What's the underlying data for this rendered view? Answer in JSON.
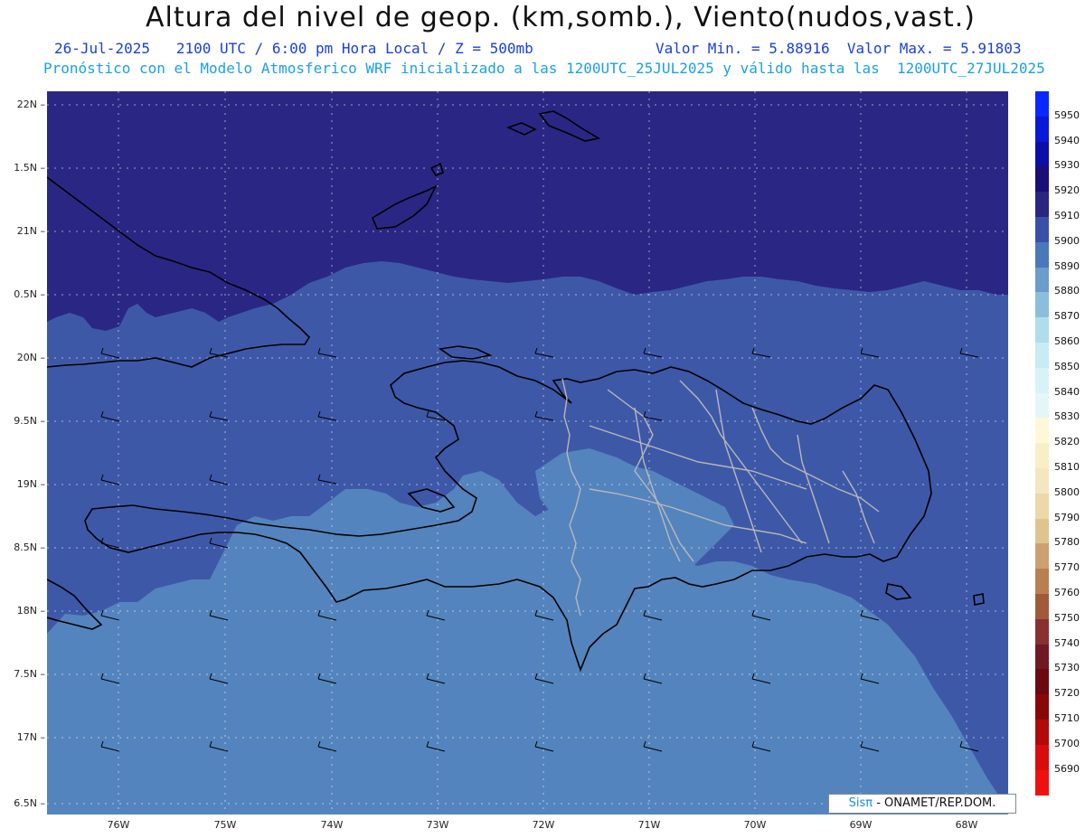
{
  "header": {
    "title": "Altura del nivel de geop. (km,somb.), Viento(nudos,vast.)",
    "date_time": "26-Jul-2025   2100 UTC / 6:00 pm Hora Local / Z = 500mb",
    "min_max": "Valor Min. = 5.88916  Valor Max. = 5.91803",
    "run_info": "Pronóstico con el Modelo Atmosferico WRF inicializado a las 1200UTC_25JUL2025 y válido hasta las  1200UTC_27JUL2025"
  },
  "axes": {
    "lat_labels": [
      "22N",
      "1.5N",
      "21N",
      "0.5N",
      "20N",
      "9.5N",
      "19N",
      "8.5N",
      "18N",
      "7.5N",
      "17N",
      "6.5N"
    ],
    "lon_labels": [
      "76W",
      "75W",
      "74W",
      "73W",
      "72W",
      "71W",
      "70W",
      "69W",
      "68W"
    ]
  },
  "colorbar": {
    "levels": [
      "5950",
      "5940",
      "5930",
      "5920",
      "5910",
      "5900",
      "5890",
      "5880",
      "5870",
      "5860",
      "5850",
      "5840",
      "5830",
      "5820",
      "5810",
      "5800",
      "5790",
      "5780",
      "5770",
      "5760",
      "5750",
      "5740",
      "5730",
      "5720",
      "5710",
      "5700",
      "5690"
    ],
    "colors": [
      "#0a28ff",
      "#0a18d8",
      "#0c0ea8",
      "#1a0e78",
      "#2a2580",
      "#3a50a8",
      "#4a78b8",
      "#6a9ccc",
      "#8cbedc",
      "#b0dcec",
      "#c8ecf4",
      "#d8f2f8",
      "#e4f6f8",
      "#fff8d8",
      "#f8eec8",
      "#f4e6c0",
      "#ecd8a8",
      "#e0c490",
      "#cca070",
      "#b88050",
      "#a05a3a",
      "#883030",
      "#701824",
      "#6a0a10",
      "#880808",
      "#b00a0a",
      "#d80c0c",
      "#f01010"
    ]
  },
  "credit": {
    "brand": "Sisπ",
    "org": " - ONAMET/REP.DOM."
  }
}
